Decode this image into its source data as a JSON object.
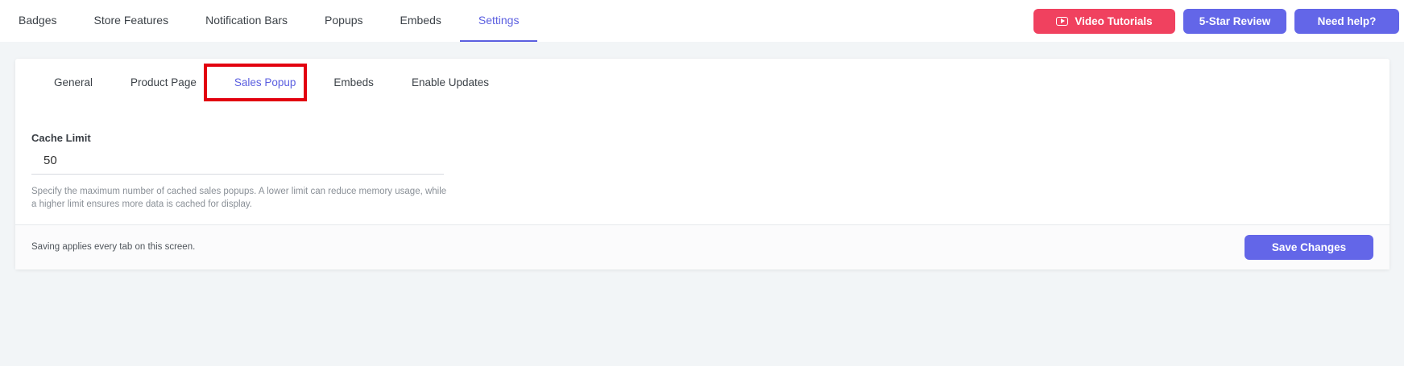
{
  "nav": {
    "tabs": [
      {
        "label": "Badges"
      },
      {
        "label": "Store Features"
      },
      {
        "label": "Notification Bars"
      },
      {
        "label": "Popups"
      },
      {
        "label": "Embeds"
      },
      {
        "label": "Settings"
      }
    ],
    "active": "Settings"
  },
  "actions": {
    "video_tutorials": "Video Tutorials",
    "review": "5-Star Review",
    "help": "Need help?"
  },
  "settings": {
    "tabs": [
      {
        "label": "General"
      },
      {
        "label": "Product Page"
      },
      {
        "label": "Sales Popup"
      },
      {
        "label": "Embeds"
      },
      {
        "label": "Enable Updates"
      }
    ],
    "active": "Sales Popup",
    "cache_limit": {
      "label": "Cache Limit",
      "value": "50",
      "help": "Specify the maximum number of cached sales popups. A lower limit can reduce memory usage, while a higher limit ensures more data is cached for display."
    },
    "footer_note": "Saving applies every tab on this screen.",
    "save_label": "Save Changes"
  },
  "colors": {
    "accent": "#5b5fe0",
    "button_indigo": "#6366e8",
    "button_red": "#f0415f",
    "highlight": "#e2000f"
  },
  "icons": {
    "video": "youtube-play-icon"
  }
}
